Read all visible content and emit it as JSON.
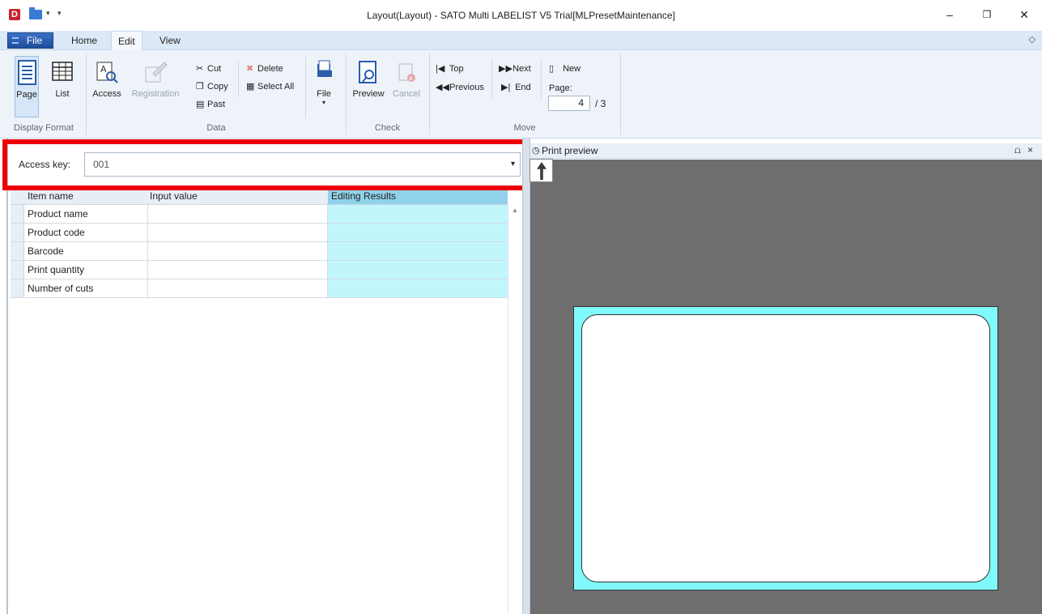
{
  "window": {
    "title": "Layout(Layout) - SATO Multi LABELIST V5 Trial[MLPresetMaintenance]",
    "app_icon_letter": "D",
    "controls": {
      "minimize": "–",
      "restore": "❐",
      "close": "✕"
    }
  },
  "ribbon": {
    "tabs": [
      {
        "label": "File"
      },
      {
        "label": "Home"
      },
      {
        "label": "Edit"
      },
      {
        "label": "View"
      }
    ],
    "active_tab": "Edit",
    "groups": {
      "display_format": {
        "label": "Display Format",
        "page": "Page",
        "list": "List"
      },
      "data": {
        "label": "Data",
        "access": "Access",
        "registration": "Registration",
        "cut": "Cut",
        "copy": "Copy",
        "paste": "Past",
        "delete": "Delete",
        "select_all": "Select All",
        "file": "File"
      },
      "check": {
        "label": "Check",
        "preview": "Preview",
        "cancel": "Cancel"
      },
      "move": {
        "label": "Move",
        "top": "Top",
        "previous": "Previous",
        "next": "Next",
        "end": "End",
        "new": "New",
        "page_label": "Page:",
        "page_value": "4",
        "page_total": "/ 3"
      }
    }
  },
  "access": {
    "label": "Access key:",
    "value": "001"
  },
  "grid": {
    "columns": [
      "Item name",
      "Input value",
      "Editing Results"
    ],
    "rows": [
      {
        "item": "Product name",
        "input": "",
        "result": ""
      },
      {
        "item": "Product code",
        "input": "",
        "result": ""
      },
      {
        "item": "Barcode",
        "input": "",
        "result": ""
      },
      {
        "item": "Print quantity",
        "input": "",
        "result": ""
      },
      {
        "item": "Number of cuts",
        "input": "",
        "result": ""
      }
    ]
  },
  "preview": {
    "title": "Print preview",
    "pin": "⩍",
    "close": "×"
  },
  "colors": {
    "highlight": "#ee0000",
    "label_bg": "#7ff9fb",
    "result_cell": "#c2f6fb",
    "file_tab": "#2b579a"
  }
}
